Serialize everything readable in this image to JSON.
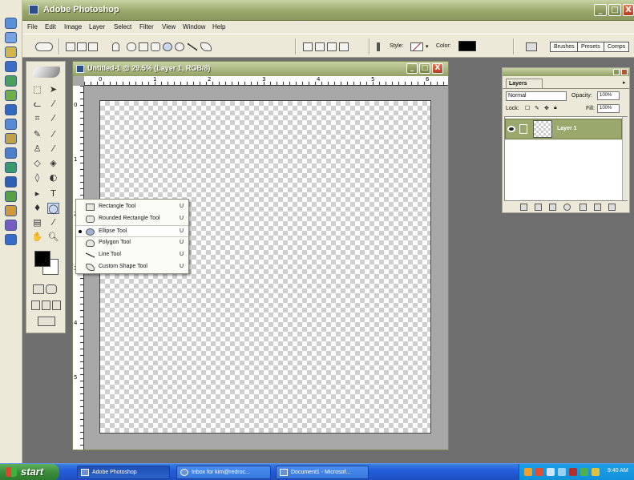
{
  "app": {
    "title": "Adobe Photoshop",
    "window_buttons": [
      "_",
      "□",
      "X"
    ]
  },
  "menu": [
    "File",
    "Edit",
    "Image",
    "Layer",
    "Select",
    "Filter",
    "View",
    "Window",
    "Help"
  ],
  "options": {
    "style_label": "Style:",
    "color_label": "Color:",
    "color_value": "#000000",
    "wells": [
      "Brushes",
      "Presets",
      "Comps"
    ]
  },
  "document": {
    "title": "Untitled-1 @ 29.5% (Layer 1, RGB/8)",
    "hruler": [
      "0",
      "1",
      "2",
      "3",
      "4",
      "5",
      "6"
    ],
    "vruler": [
      "0",
      "1",
      "2",
      "3",
      "4",
      "5"
    ]
  },
  "flyout": {
    "items": [
      {
        "label": "Rectangle Tool",
        "key": "U",
        "icon": "rectangle-icon"
      },
      {
        "label": "Rounded Rectangle Tool",
        "key": "U",
        "icon": "rounded-rectangle-icon"
      },
      {
        "label": "Ellipse Tool",
        "key": "U",
        "icon": "ellipse-icon",
        "selected": true
      },
      {
        "label": "Polygon Tool",
        "key": "U",
        "icon": "polygon-icon"
      },
      {
        "label": "Line Tool",
        "key": "U",
        "icon": "line-icon"
      },
      {
        "label": "Custom Shape Tool",
        "key": "U",
        "icon": "custom-shape-icon"
      }
    ]
  },
  "layers_palette": {
    "tab": "Layers",
    "blend_mode": "Normal",
    "opacity_label": "Opacity:",
    "opacity_value": "100%",
    "lock_label": "Lock:",
    "fill_label": "Fill:",
    "fill_value": "100%",
    "layers": [
      {
        "name": "Layer 1"
      }
    ]
  },
  "taskbar": {
    "start": "start",
    "tasks": [
      "Adobe Photoshop",
      "Inbox for kim@redroc...",
      "Document1 - Microsof..."
    ],
    "clock": "9:40 AM"
  }
}
